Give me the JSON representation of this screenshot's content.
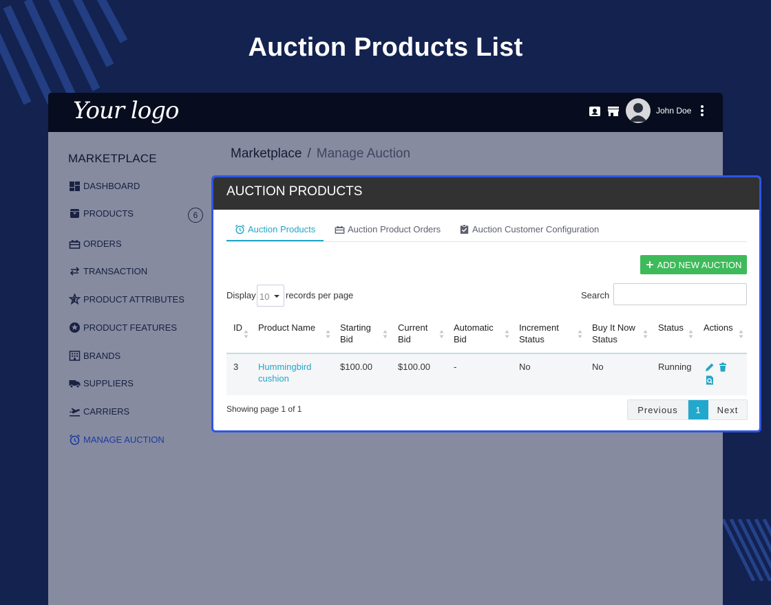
{
  "page": {
    "heading": "Auction Products List"
  },
  "topbar": {
    "logo": "Your logo",
    "username": "John Doe"
  },
  "sidebar": {
    "title": "MARKETPLACE",
    "items": [
      {
        "label": "DASHBOARD",
        "icon": "dashboard-icon"
      },
      {
        "label": "PRODUCTS",
        "icon": "archive-box-icon",
        "badge": "6"
      },
      {
        "label": "ORDERS",
        "icon": "gift-box-icon"
      },
      {
        "label": "TRANSACTION",
        "icon": "swap-arrows-icon"
      },
      {
        "label": "PRODUCT ATTRIBUTES",
        "icon": "star-edit-icon"
      },
      {
        "label": "PRODUCT FEATURES",
        "icon": "star-circle-icon"
      },
      {
        "label": "BRANDS",
        "icon": "building-icon"
      },
      {
        "label": "SUPPLIERS",
        "icon": "truck-icon"
      },
      {
        "label": "CARRIERS",
        "icon": "plane-departure-icon"
      },
      {
        "label": "MANAGE AUCTION",
        "icon": "alarm-clock-icon",
        "active": true
      }
    ]
  },
  "breadcrumb": {
    "root": "Marketplace",
    "separator": "/",
    "current": "Manage Auction"
  },
  "panel": {
    "header": "AUCTION PRODUCTS",
    "tabs": [
      {
        "label": "Auction Products",
        "icon": "alarm-clock-icon",
        "active": true
      },
      {
        "label": "Auction Product Orders",
        "icon": "gift-box-icon"
      },
      {
        "label": "Auction Customer Configuration",
        "icon": "clipboard-check-icon"
      }
    ],
    "add_button": "ADD NEW AUCTION",
    "display_label": "Display",
    "page_length": "10",
    "records_label": "records per page",
    "search_label": "Search",
    "search_value": "",
    "columns": [
      "ID",
      "Product Name",
      "Starting Bid",
      "Current Bid",
      "Automatic Bid",
      "Increment Status",
      "Buy It Now Status",
      "Status",
      "Actions"
    ],
    "rows": [
      {
        "id": "3",
        "product_name": "Hummingbird cushion",
        "starting_bid": "$100.00",
        "current_bid": "$100.00",
        "automatic_bid": "-",
        "increment_status": "No",
        "buy_it_now_status": "No",
        "status": "Running"
      }
    ],
    "info": "Showing page 1 of 1",
    "pager": {
      "previous": "Previous",
      "current": "1",
      "next": "Next"
    }
  },
  "colors": {
    "accent": "#22a6c6",
    "add_button": "#3eba5a",
    "panel_border": "#2f55e4",
    "header_bg": "#323232",
    "page_bg": "#13224f"
  }
}
